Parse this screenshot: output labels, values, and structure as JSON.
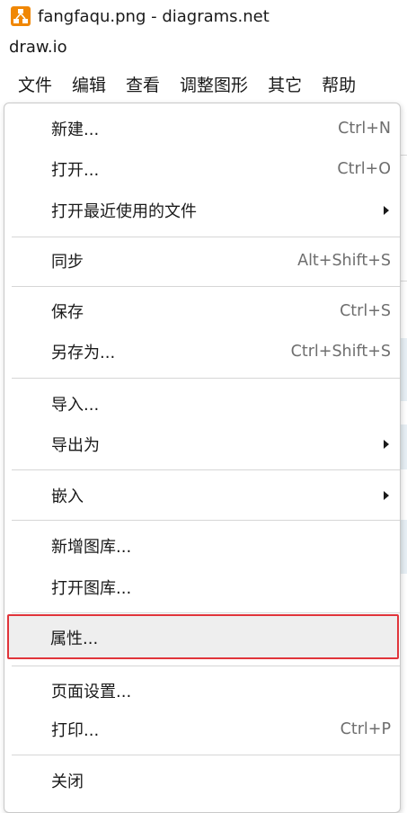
{
  "window": {
    "title": "fangfaqu.png - diagrams.net",
    "app_name": "draw.io",
    "logo_icon": "drawio-logo-icon",
    "accent_color": "#f08705"
  },
  "menubar": {
    "items": [
      {
        "label": "文件"
      },
      {
        "label": "编辑"
      },
      {
        "label": "查看"
      },
      {
        "label": "调整图形"
      },
      {
        "label": "其它"
      },
      {
        "label": "帮助"
      }
    ]
  },
  "file_menu": {
    "items": [
      {
        "label": "新建...",
        "shortcut": "Ctrl+N"
      },
      {
        "label": "打开...",
        "shortcut": "Ctrl+O"
      },
      {
        "label": "打开最近使用的文件",
        "submenu": true
      },
      {
        "label": "同步",
        "shortcut": "Alt+Shift+S"
      },
      {
        "label": "保存",
        "shortcut": "Ctrl+S"
      },
      {
        "label": "另存为...",
        "shortcut": "Ctrl+Shift+S"
      },
      {
        "label": "导入..."
      },
      {
        "label": "导出为",
        "submenu": true
      },
      {
        "label": "嵌入",
        "submenu": true
      },
      {
        "label": "新增图库..."
      },
      {
        "label": "打开图库..."
      },
      {
        "label": "属性...",
        "highlighted": true
      },
      {
        "label": "页面设置..."
      },
      {
        "label": "打印...",
        "shortcut": "Ctrl+P"
      },
      {
        "label": "关闭"
      }
    ],
    "highlight_color": "#e0343a"
  }
}
